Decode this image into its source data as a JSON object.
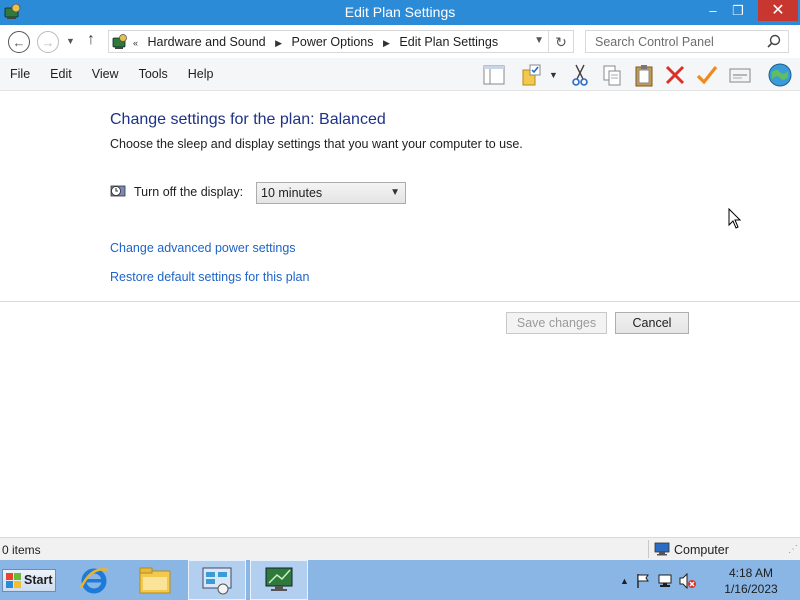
{
  "window": {
    "title": "Edit Plan Settings",
    "controls": {
      "minimize": "–",
      "maximize": "❐",
      "close": "✕"
    }
  },
  "address_bar": {
    "overflow_chevron": "«",
    "breadcrumbs": [
      "Hardware and Sound",
      "Power Options",
      "Edit Plan Settings"
    ],
    "search_placeholder": "Search Control Panel"
  },
  "menu": [
    "File",
    "Edit",
    "View",
    "Tools",
    "Help"
  ],
  "toolbar_icons": [
    "layout-pane-icon",
    "folder-check-icon",
    "cut-icon",
    "copy-icon",
    "paste-icon",
    "delete-icon",
    "checkmark-icon",
    "properties-icon",
    "globe-icon"
  ],
  "content": {
    "heading": "Change settings for the plan: Balanced",
    "description": "Choose the sleep and display settings that you want your computer to use.",
    "display_setting": {
      "label": "Turn off the display:",
      "selected": "10 minutes"
    },
    "links": {
      "advanced": "Change advanced power settings",
      "restore": "Restore default settings for this plan"
    },
    "buttons": {
      "save": "Save changes",
      "cancel": "Cancel"
    }
  },
  "status_bar": {
    "items": "0 items",
    "location": "Computer"
  },
  "taskbar": {
    "start_label": "Start",
    "apps": [
      "internet-explorer-icon",
      "file-explorer-icon",
      "control-panel-icon",
      "remote-desktop-icon"
    ],
    "time": "4:18 AM",
    "date": "1/16/2023"
  },
  "colors": {
    "titlebar": "#2c8bd7",
    "heading": "#1e3287",
    "link": "#1e64c8",
    "taskbar": "#8ab6e6",
    "close_button": "#c7372f"
  }
}
